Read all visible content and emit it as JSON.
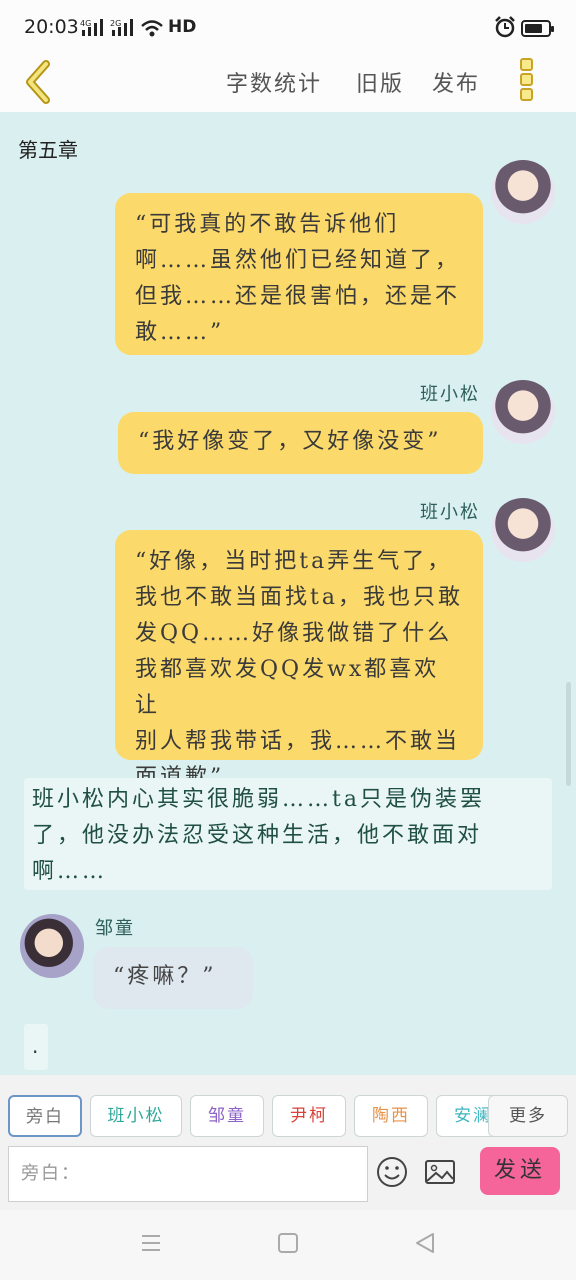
{
  "status_bar": {
    "time": "20:03",
    "signal1": "4G",
    "signal2": "2G",
    "network": "HD",
    "battery_level": 0.75
  },
  "nav": {
    "word_count": "字数统计",
    "old_version": "旧版",
    "publish": "发布"
  },
  "chapter": "第五章",
  "messages": [
    {
      "sender": "",
      "text_lines": [
        "“可我真的不敢告诉他们",
        "啊……虽然他们已经知道了，",
        "但我……还是很害怕，还是不",
        "敢……”"
      ]
    },
    {
      "sender": "班小松",
      "text": "“我好像变了，又好像没变”"
    },
    {
      "sender": "班小松",
      "text_lines": [
        "“好像，当时把ta弄生气了，",
        "我也不敢当面找ta，我也只敢",
        "发QQ……好像我做错了什么",
        "我都喜欢发QQ发wx都喜欢让",
        "别人帮我带话，我……不敢当",
        "面道歉”"
      ]
    },
    {
      "sender": "",
      "narration_lines": [
        "班小松内心其实很脆弱……ta只是伪装罢",
        "了，他没办法忍受这种生活，他不敢面对",
        "啊……"
      ]
    },
    {
      "sender": "邹童",
      "text": "“疼嘛？”"
    },
    {
      "sender": "",
      "text": "."
    }
  ],
  "roles": [
    {
      "label": "旁白",
      "color": "#777777"
    },
    {
      "label": "班小松",
      "color": "#2fa89a"
    },
    {
      "label": "邹童",
      "color": "#8e63c7"
    },
    {
      "label": "尹柯",
      "color": "#d9423a"
    },
    {
      "label": "陶西",
      "color": "#e8924a"
    },
    {
      "label": "安澜",
      "color": "#3fb5c0"
    }
  ],
  "more_roles": "更多",
  "input": {
    "placeholder": "旁白："
  },
  "send_label": "发送"
}
